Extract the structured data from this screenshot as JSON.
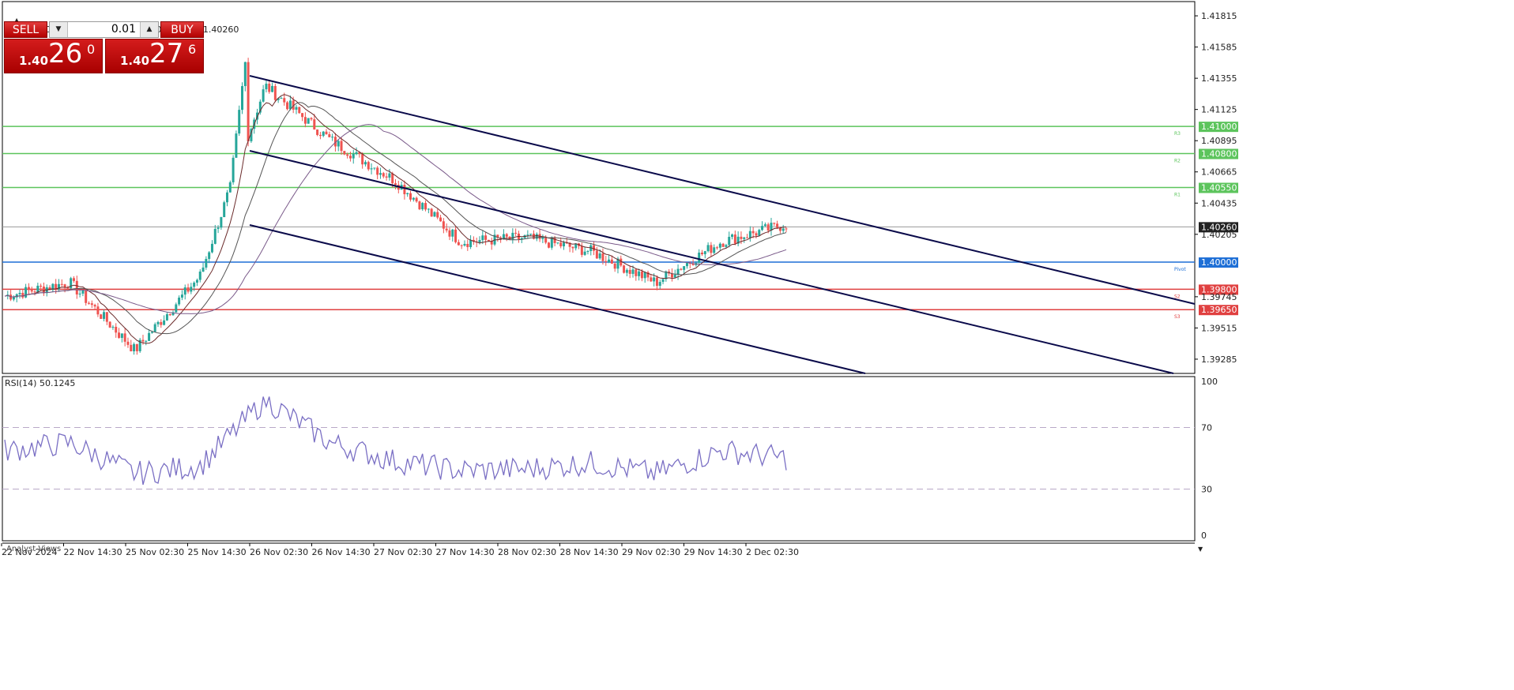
{
  "header": {
    "symbol_info": "USDCADm,M30  1.40294 1.40300 1.40260 1.40260"
  },
  "trade_panel": {
    "sell_label": "SELL",
    "buy_label": "BUY",
    "lot_value": "0.01",
    "bid": {
      "prefix": "1.40",
      "big": "26",
      "sup": "0"
    },
    "ask": {
      "prefix": "1.40",
      "big": "27",
      "sup": "6"
    }
  },
  "price_axis": {
    "ticks": [
      "1.41815",
      "1.41585",
      "1.41355",
      "1.41125",
      "1.40895",
      "1.40665",
      "1.40435",
      "1.40205",
      "1.39745",
      "1.39515",
      "1.39285"
    ]
  },
  "levels": [
    {
      "price": 1.41,
      "label": "1.41000",
      "tag": "R3",
      "color": "#5cc45c",
      "kind": "resistance"
    },
    {
      "price": 1.408,
      "label": "1.40800",
      "tag": "R2",
      "color": "#5cc45c",
      "kind": "resistance"
    },
    {
      "price": 1.4055,
      "label": "1.40550",
      "tag": "R1",
      "color": "#5cc45c",
      "kind": "resistance"
    },
    {
      "price": 1.4,
      "label": "1.40000",
      "tag": "Pivot",
      "color": "#1e6fd6",
      "kind": "pivot"
    },
    {
      "price": 1.398,
      "label": "1.39800",
      "tag": "S2",
      "color": "#e04040",
      "kind": "support"
    },
    {
      "price": 1.3965,
      "label": "1.39650",
      "tag": "S3",
      "color": "#e04040",
      "kind": "support"
    }
  ],
  "current_price": {
    "value": 1.4026,
    "label": "1.40260"
  },
  "rsi": {
    "title": "RSI(14) 50.1245",
    "levels": [
      "100",
      "70",
      "30",
      "0"
    ]
  },
  "time_axis": {
    "labels": [
      "22 Nov 2024",
      "22 Nov 14:30",
      "25 Nov 02:30",
      "25 Nov 14:30",
      "26 Nov 02:30",
      "26 Nov 14:30",
      "27 Nov 02:30",
      "27 Nov 14:30",
      "28 Nov 02:30",
      "28 Nov 14:30",
      "29 Nov 02:30",
      "29 Nov 14:30",
      "2 Dec 02:30"
    ]
  },
  "bottom_tab": {
    "label": "Analyst Views"
  },
  "colors": {
    "bull_candle": "#26a69a",
    "bear_candle": "#ef5350",
    "channel": "#0a0a4a",
    "rsi_line": "#7a6fc4",
    "ma_fast": "#6b2b2b",
    "ma_mid": "#555555",
    "ma_slow": "#7a5a8a"
  },
  "chart_data": {
    "type": "line",
    "title": "USDCADm,M30",
    "x": [
      "22 Nov 2024",
      "22 Nov 14:30",
      "25 Nov 02:30",
      "25 Nov 14:30",
      "26 Nov 02:30",
      "26 Nov 14:30",
      "27 Nov 02:30",
      "27 Nov 14:30",
      "28 Nov 02:30",
      "28 Nov 14:30",
      "29 Nov 02:30",
      "29 Nov 14:30",
      "2 Dec 02:30"
    ],
    "ylim": [
      1.3918,
      1.4192
    ],
    "series": [
      {
        "values": [
          1.3975,
          1.3985,
          1.3935,
          1.399,
          1.413,
          1.409,
          1.406,
          1.4015,
          1.4018,
          1.4008,
          1.3985,
          1.4015,
          1.4028
        ]
      }
    ],
    "rsi_values": [
      55,
      60,
      40,
      45,
      88,
      60,
      48,
      42,
      43,
      47,
      40,
      55,
      50
    ]
  }
}
